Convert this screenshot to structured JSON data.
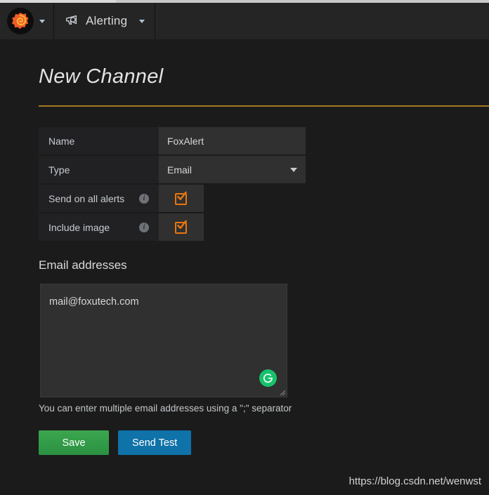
{
  "navbar": {
    "logo_icon": "grafana-logo-icon",
    "logo_caret_icon": "chevron-down-icon",
    "alerting_icon": "megaphone-icon",
    "alerting_label": "Alerting",
    "alerting_caret_icon": "chevron-down-icon"
  },
  "page": {
    "title": "New Channel"
  },
  "form": {
    "rows": [
      {
        "label": "Name",
        "value": "FoxAlert",
        "kind": "text"
      },
      {
        "label": "Type",
        "value": "Email",
        "kind": "select"
      },
      {
        "label": "Send on all alerts",
        "info_icon": "info-icon",
        "checked": true,
        "kind": "checkbox"
      },
      {
        "label": "Include image",
        "info_icon": "info-icon",
        "checked": true,
        "kind": "checkbox"
      }
    ],
    "type_options": [
      "Email"
    ]
  },
  "email_section": {
    "heading": "Email addresses",
    "textarea_value": "mail@foxutech.com",
    "textarea_placeholder": "",
    "grammarly_icon": "grammarly-g-icon",
    "resize_handle_icon": "resize-handle-icon",
    "help_text": "You can enter multiple email addresses using a \";\" separator"
  },
  "actions": {
    "save_label": "Save",
    "send_test_label": "Send Test"
  },
  "watermark": {
    "text": "https://blog.csdn.net/wenwst"
  },
  "colors": {
    "navbar_bg": "#252525",
    "body_bg": "#1b1b1b",
    "label_cell_bg": "#212124",
    "value_cell_bg": "#303030",
    "accent_orange": "#e8760e",
    "divider_gold": "#a07a23",
    "save_green": "#3ca64e",
    "send_test_blue": "#0f72a8",
    "grammarly_green": "#15c26b"
  }
}
